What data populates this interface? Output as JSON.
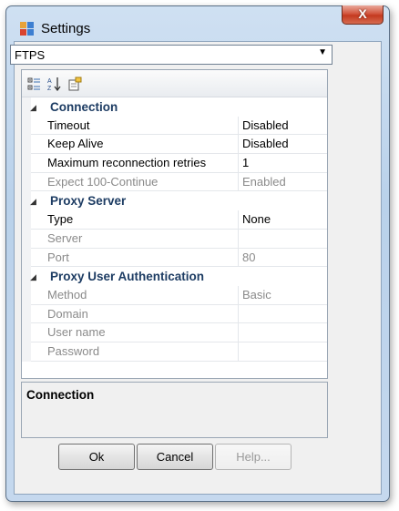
{
  "window": {
    "title": "Settings",
    "close_label": "X"
  },
  "protocol_select": {
    "value": "FTPS"
  },
  "toolbar": {
    "icons": [
      "categorized-icon",
      "alphabetical-sort-icon",
      "property-pages-icon"
    ]
  },
  "categories": [
    {
      "title": "Connection",
      "props": [
        {
          "name": "Timeout",
          "value": "Disabled",
          "enabled": true
        },
        {
          "name": "Keep Alive",
          "value": "Disabled",
          "enabled": true
        },
        {
          "name": "Maximum reconnection retries",
          "value": "1",
          "enabled": true
        },
        {
          "name": "Expect 100-Continue",
          "value": "Enabled",
          "enabled": false
        }
      ]
    },
    {
      "title": "Proxy Server",
      "props": [
        {
          "name": "Type",
          "value": "None",
          "enabled": true
        },
        {
          "name": "Server",
          "value": "",
          "enabled": false
        },
        {
          "name": "Port",
          "value": "80",
          "enabled": false
        }
      ]
    },
    {
      "title": "Proxy User Authentication",
      "props": [
        {
          "name": "Method",
          "value": "Basic",
          "enabled": false
        },
        {
          "name": "Domain",
          "value": "",
          "enabled": false
        },
        {
          "name": "User name",
          "value": "",
          "enabled": false
        },
        {
          "name": "Password",
          "value": "",
          "enabled": false
        }
      ]
    }
  ],
  "description": {
    "title": "Connection"
  },
  "buttons": {
    "ok": "Ok",
    "cancel": "Cancel",
    "help": "Help..."
  },
  "colors": {
    "category_text": "#1d3c63",
    "disabled_text": "#8a8a8a",
    "close_button": "#c4391f"
  }
}
